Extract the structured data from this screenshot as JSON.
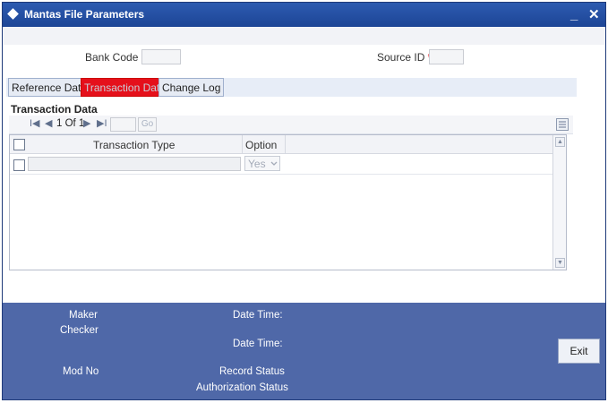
{
  "window": {
    "title": "Mantas File Parameters",
    "minimize": "_",
    "close": "✕"
  },
  "form": {
    "bank_code_label": "Bank Code",
    "source_id_label": "Source ID",
    "required_mark": "*"
  },
  "tabs": [
    {
      "label": "Reference Data",
      "active": false
    },
    {
      "label": "Transaction Data",
      "active": true
    },
    {
      "label": "Change Log",
      "active": false
    }
  ],
  "section": {
    "title": "Transaction Data"
  },
  "pager": {
    "first": "I◀",
    "prev": "◀",
    "page_text": "1 Of 1",
    "next": "▶",
    "last": "▶I",
    "go_label": "Go"
  },
  "grid": {
    "columns": [
      "Transaction Type",
      "Option"
    ],
    "rows": [
      {
        "transaction_type": "",
        "option": "Yes"
      }
    ]
  },
  "footer": {
    "maker_label": "Maker",
    "checker_label": "Checker",
    "date_time_label_1": "Date Time:",
    "date_time_label_2": "Date Time:",
    "mod_no_label": "Mod No",
    "record_status_label": "Record Status",
    "authorization_status_label": "Authorization Status",
    "exit_label": "Exit"
  }
}
